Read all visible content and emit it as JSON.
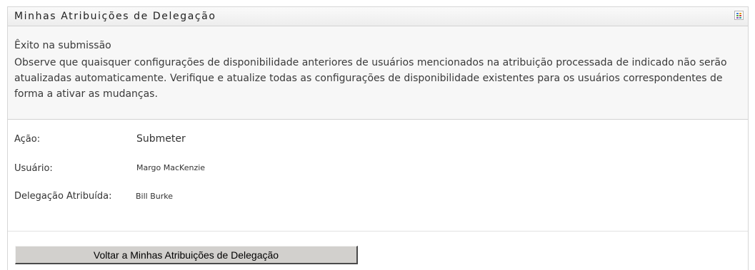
{
  "panel": {
    "title": "Minhas Atribuições de Delegação",
    "menu_icon": "panel-menu-icon",
    "menu_icon_colors": [
      "#4a7fd4",
      "#e0a020",
      "#5aa845",
      "#c84040",
      "#8a5ab8",
      "#3aa0a0"
    ]
  },
  "message": {
    "title": "Êxito na submissão",
    "body": "Observe que quaisquer configurações de disponibilidade anteriores de usuários mencionados na atribuição processada de indicado não serão atualizadas automaticamente. Verifique e atualize todas as configurações de disponibilidade existentes para os usuários correspondentes de forma a ativar as mudanças."
  },
  "details": {
    "action_label": "Ação:",
    "action_value": "Submeter",
    "user_label": "Usuário:",
    "user_value": "Margo MacKenzie",
    "delegate_label": "Delegação Atribuída:",
    "delegate_value": "Bill Burke"
  },
  "actions": {
    "back_label": "Voltar a Minhas Atribuições de Delegação"
  }
}
